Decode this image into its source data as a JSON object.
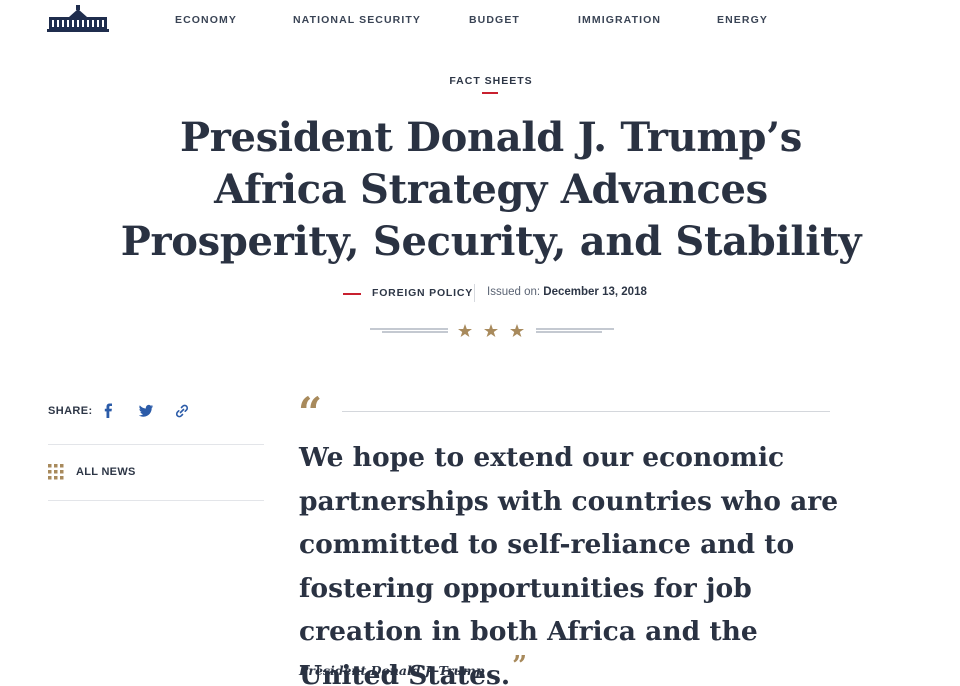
{
  "nav": {
    "items": [
      "ECONOMY",
      "NATIONAL SECURITY",
      "BUDGET",
      "IMMIGRATION",
      "ENERGY"
    ]
  },
  "article": {
    "eyebrow": "FACT SHEETS",
    "title": "President Donald J. Trump’s Africa Strategy Advances Prosperity, Security, and Stability",
    "category": "FOREIGN POLICY",
    "issued_label": "Issued on:",
    "issued_date": "December 13, 2018"
  },
  "sidebar": {
    "share_label": "SHARE:",
    "share_icons": [
      "facebook-icon",
      "twitter-icon",
      "link-icon"
    ],
    "all_news_label": "ALL NEWS"
  },
  "quote": {
    "open_mark": "“",
    "text": "We hope to extend our economic partnerships with countries who are committed to self-reliance and to fostering opportunities for job creation in both Africa and the United States.",
    "close_mark": "”",
    "author": "President Donald J. Trump"
  },
  "colors": {
    "navy": "#2a3242",
    "accent_red": "#c8202f",
    "gold": "#a88a5c",
    "rule": "#d4d7dc"
  }
}
